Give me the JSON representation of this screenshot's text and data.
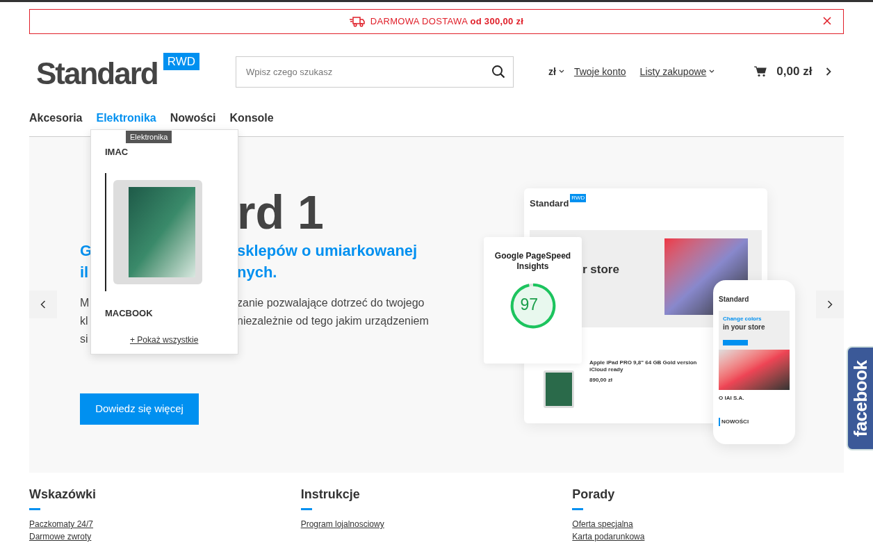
{
  "promo_bar": {
    "text": "DARMOWA DOSTAWA **od 300,00 zł**"
  },
  "header": {
    "logo": {
      "text": "Standard",
      "badge": "RWD"
    },
    "search": {
      "placeholder": "Wpisz czego szukasz"
    },
    "currency": "zł",
    "account_link": "Twoje konto",
    "lists_link": "Listy zakupowe",
    "cart_total": "0,00 zł"
  },
  "nav": [
    {
      "label": "Akcesoria",
      "selected": false
    },
    {
      "label": "Elektronika",
      "selected": true
    },
    {
      "label": "Nowości",
      "selected": false
    },
    {
      "label": "Konsole",
      "selected": false
    }
  ],
  "dropdown": {
    "tooltip": "Elektronika",
    "items": [
      {
        "label": "IMAC",
        "kind": "image"
      },
      {
        "label": "MACBOOK",
        "kind": "plain"
      }
    ],
    "show_all": "+ Pokaż wszystkie"
  },
  "hero": {
    "title": [
      {
        "right": "rd 1"
      }
    ],
    "subtitle": [
      {
        "left": "G",
        "right": "sklepów o umiarkowanej"
      },
      {
        "left": "il",
        "right": "nych."
      }
    ],
    "body": [
      {
        "left": "M",
        "right": "zanie pozwalające dotrzeć do twojego"
      },
      {
        "left": "kl",
        "right": "niezależnie od tego jakim urządzeniem"
      },
      {
        "left": "si"
      }
    ],
    "button": "Dowiedz się więcej",
    "promo_image": {
      "pagespeed_title": "Google PageSpeed Insights",
      "score": "97",
      "desktop_logo": "Standard",
      "desktop_badge": "RWD",
      "desktop_headline": "r store",
      "product_title": "Apple iPad PRO 9,8\" 64 GB Gold version iCloud ready",
      "product_price": "890,00 zł",
      "phone_logo": "Standard",
      "phone_kicker": "Change colors",
      "phone_headline": "in your store",
      "phone_about": "O IAI S.A.",
      "phone_section": "NOWOŚCI"
    }
  },
  "social_tab": {
    "label": "facebook"
  },
  "footer": [
    {
      "title": "Wskazówki",
      "links": [
        "Paczkomaty 24/7",
        "Darmowe zwroty"
      ]
    },
    {
      "title": "Instrukcje",
      "links": [
        "Program lojalnosciowy"
      ]
    },
    {
      "title": "Porady",
      "links": [
        "Oferta specjalna",
        "Karta podarunkowa"
      ]
    }
  ]
}
